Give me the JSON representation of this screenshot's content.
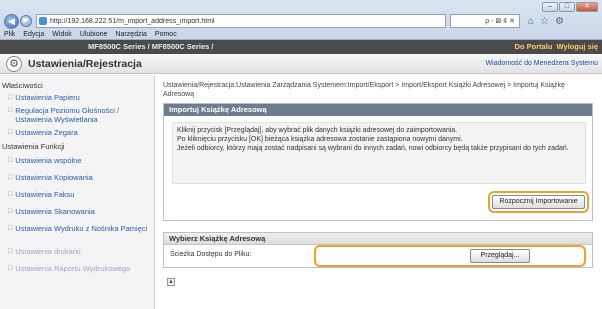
{
  "browser": {
    "window_buttons": {
      "minimize": "‒",
      "maximize": "□",
      "close": "✕"
    },
    "url": "http://192.168.222.51/m_import_address_import.html",
    "url_controls": "ρ - ⊠ ¢ ✕",
    "menu": [
      "Plik",
      "Edycja",
      "Widok",
      "Ulubione",
      "Narzędzia",
      "Pomoc"
    ]
  },
  "app": {
    "device": "MF8500C Series / MF8500C Series /",
    "portal_link": "Do Portalu",
    "logout_link": "Wyloguj się",
    "title": "Ustawienia/Rejestracja",
    "system_manager_message": "Wiadomość do Menedżera Systemu"
  },
  "sidebar": {
    "preferences_heading": "Właściwości",
    "preferences_items": [
      "Ustawienia Papieru",
      "Regulacja Poziomu Głośności / Ustawienia Wyświetlania",
      "Ustawienia Zegara"
    ],
    "function_heading": "Ustawienia Funkcji",
    "function_items": [
      "Ustawienia wspólne",
      "Ustawienia Kopiowania",
      "Ustawienia Faksu",
      "Ustawienia Skanowania",
      "Ustawienia Wydruku z Nośnika Pamięci",
      "Ustawienia drukarki",
      "Ustawienia Raportu Wydrukowego"
    ]
  },
  "main": {
    "breadcrumb": "Ustawienia/Rejestracja:Ustawienia Zarządzania Systemem:Import/Eksport > Import/Eksport Książki Adresowej > Importuj Książkę Adresową",
    "import_panel": {
      "heading": "Importuj Książkę Adresową",
      "instructions": [
        "Kliknij przycisk [Przeglądaj], aby wybrać plik danych książki adresowej do zaimportowania.",
        "Po kliknięciu przycisku [OK] bieżąca książka adresowa zostanie zastąpiona nowymi danymi.",
        "Jeżeli odbiorcy, którzy mają zostać nadpisani są wybrani do innych zadań, nowi odbiorcy będą także przypisani do tych zadań."
      ],
      "start_button": "Rozpocznij Importowanie"
    },
    "select_panel": {
      "heading": "Wybierz Książkę Adresową",
      "file_path_label": "Ścieżka Dostępu do Pliku:",
      "browse_button": "Przeglądaj..."
    }
  },
  "colors": {
    "highlight": "#f0a030",
    "panel_header": "#6f7c8f",
    "link": "#2a5ca8",
    "app_header": "#4a4a4a"
  }
}
